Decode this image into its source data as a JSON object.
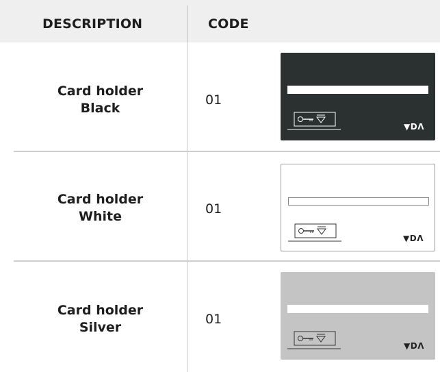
{
  "table": {
    "headers": {
      "description": "DESCRIPTION",
      "code": "CODE"
    },
    "rows": [
      {
        "line1": "Card holder",
        "line2": "Black",
        "code": "01",
        "logo": "▼DΛ",
        "card_color": "#2b3030"
      },
      {
        "line1": "Card holder",
        "line2": "White",
        "code": "01",
        "logo": "▼DΛ",
        "card_color": "#ffffff"
      },
      {
        "line1": "Card holder",
        "line2": "Silver",
        "code": "01",
        "logo": "▼DΛ",
        "card_color": "#c4c4c4"
      }
    ]
  },
  "icons": {
    "card_reader": "key-card-icon"
  }
}
